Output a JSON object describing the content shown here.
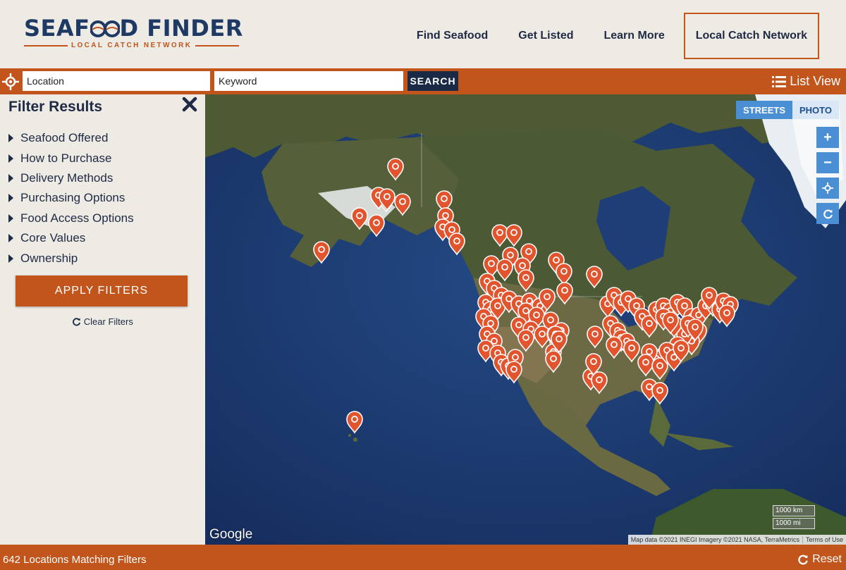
{
  "header": {
    "logo_left": "SEAF",
    "logo_right": "D FINDER",
    "logo_sub": "LOCAL CATCH NETWORK",
    "nav": [
      "Find Seafood",
      "Get Listed",
      "Learn More"
    ],
    "nav_cta": "Local Catch Network"
  },
  "search": {
    "location_placeholder": "Location",
    "keyword_placeholder": "Keyword",
    "button": "SEARCH",
    "list_view": "List View"
  },
  "sidebar": {
    "title": "Filter Results",
    "filters": [
      "Seafood Offered",
      "How to Purchase",
      "Delivery Methods",
      "Purchasing Options",
      "Food Access Options",
      "Core Values",
      "Ownership"
    ],
    "apply": "APPLY FILTERS",
    "clear": "Clear Filters"
  },
  "map": {
    "layers": {
      "streets": "STREETS",
      "photo": "PHOTO"
    },
    "active_layer": "STREETS",
    "google": "Google",
    "attribution": "Map data ©2021 INEGI Imagery ©2021 NASA, TerraMetrics",
    "terms": "Terms of Use",
    "scale_km": "1000 km",
    "scale_mi": "1000 mi",
    "marker_color": "#e2542d"
  },
  "footer": {
    "count": "642 Locations Matching Filters",
    "reset": "Reset"
  },
  "colors": {
    "accent": "#c1551c",
    "navy": "#1f2a44",
    "map_control": "#4a8fd4"
  }
}
